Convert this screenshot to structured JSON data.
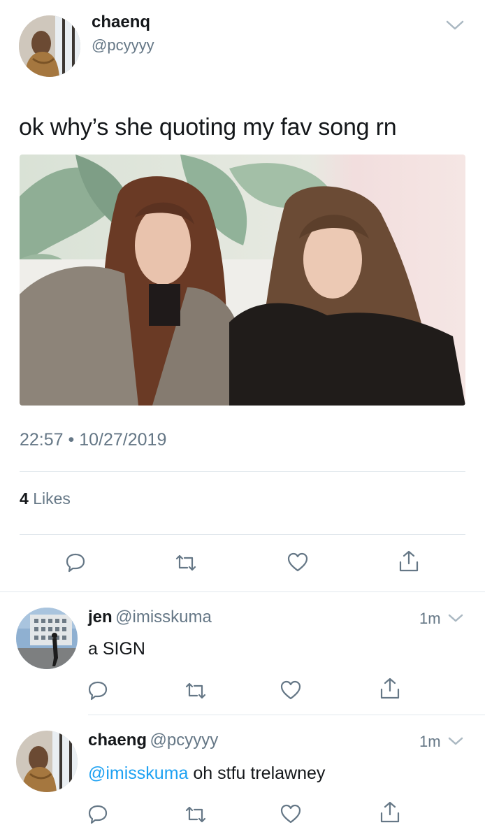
{
  "tweet": {
    "name": "chaenq",
    "handle": "@pcyyyy",
    "text": "ok why’s she quoting my fav song rn",
    "time": "22:57",
    "separator": "•",
    "date": "10/27/2019",
    "likes_count": "4",
    "likes_label": "Likes",
    "actions": [
      "reply-icon",
      "retweet-icon",
      "like-icon",
      "share-icon"
    ]
  },
  "replies": [
    {
      "name": "jen",
      "handle": "@imisskuma",
      "time": "1m",
      "text": "a SIGN"
    },
    {
      "name": "chaeng",
      "handle": "@pcyyyy",
      "time": "1m",
      "mention": "@imisskuma",
      "text": " oh stfu trelawney"
    }
  ],
  "colors": {
    "text": "#14171a",
    "secondary": "#657786",
    "link": "#1da1f2",
    "divider": "#e1e8ed"
  }
}
